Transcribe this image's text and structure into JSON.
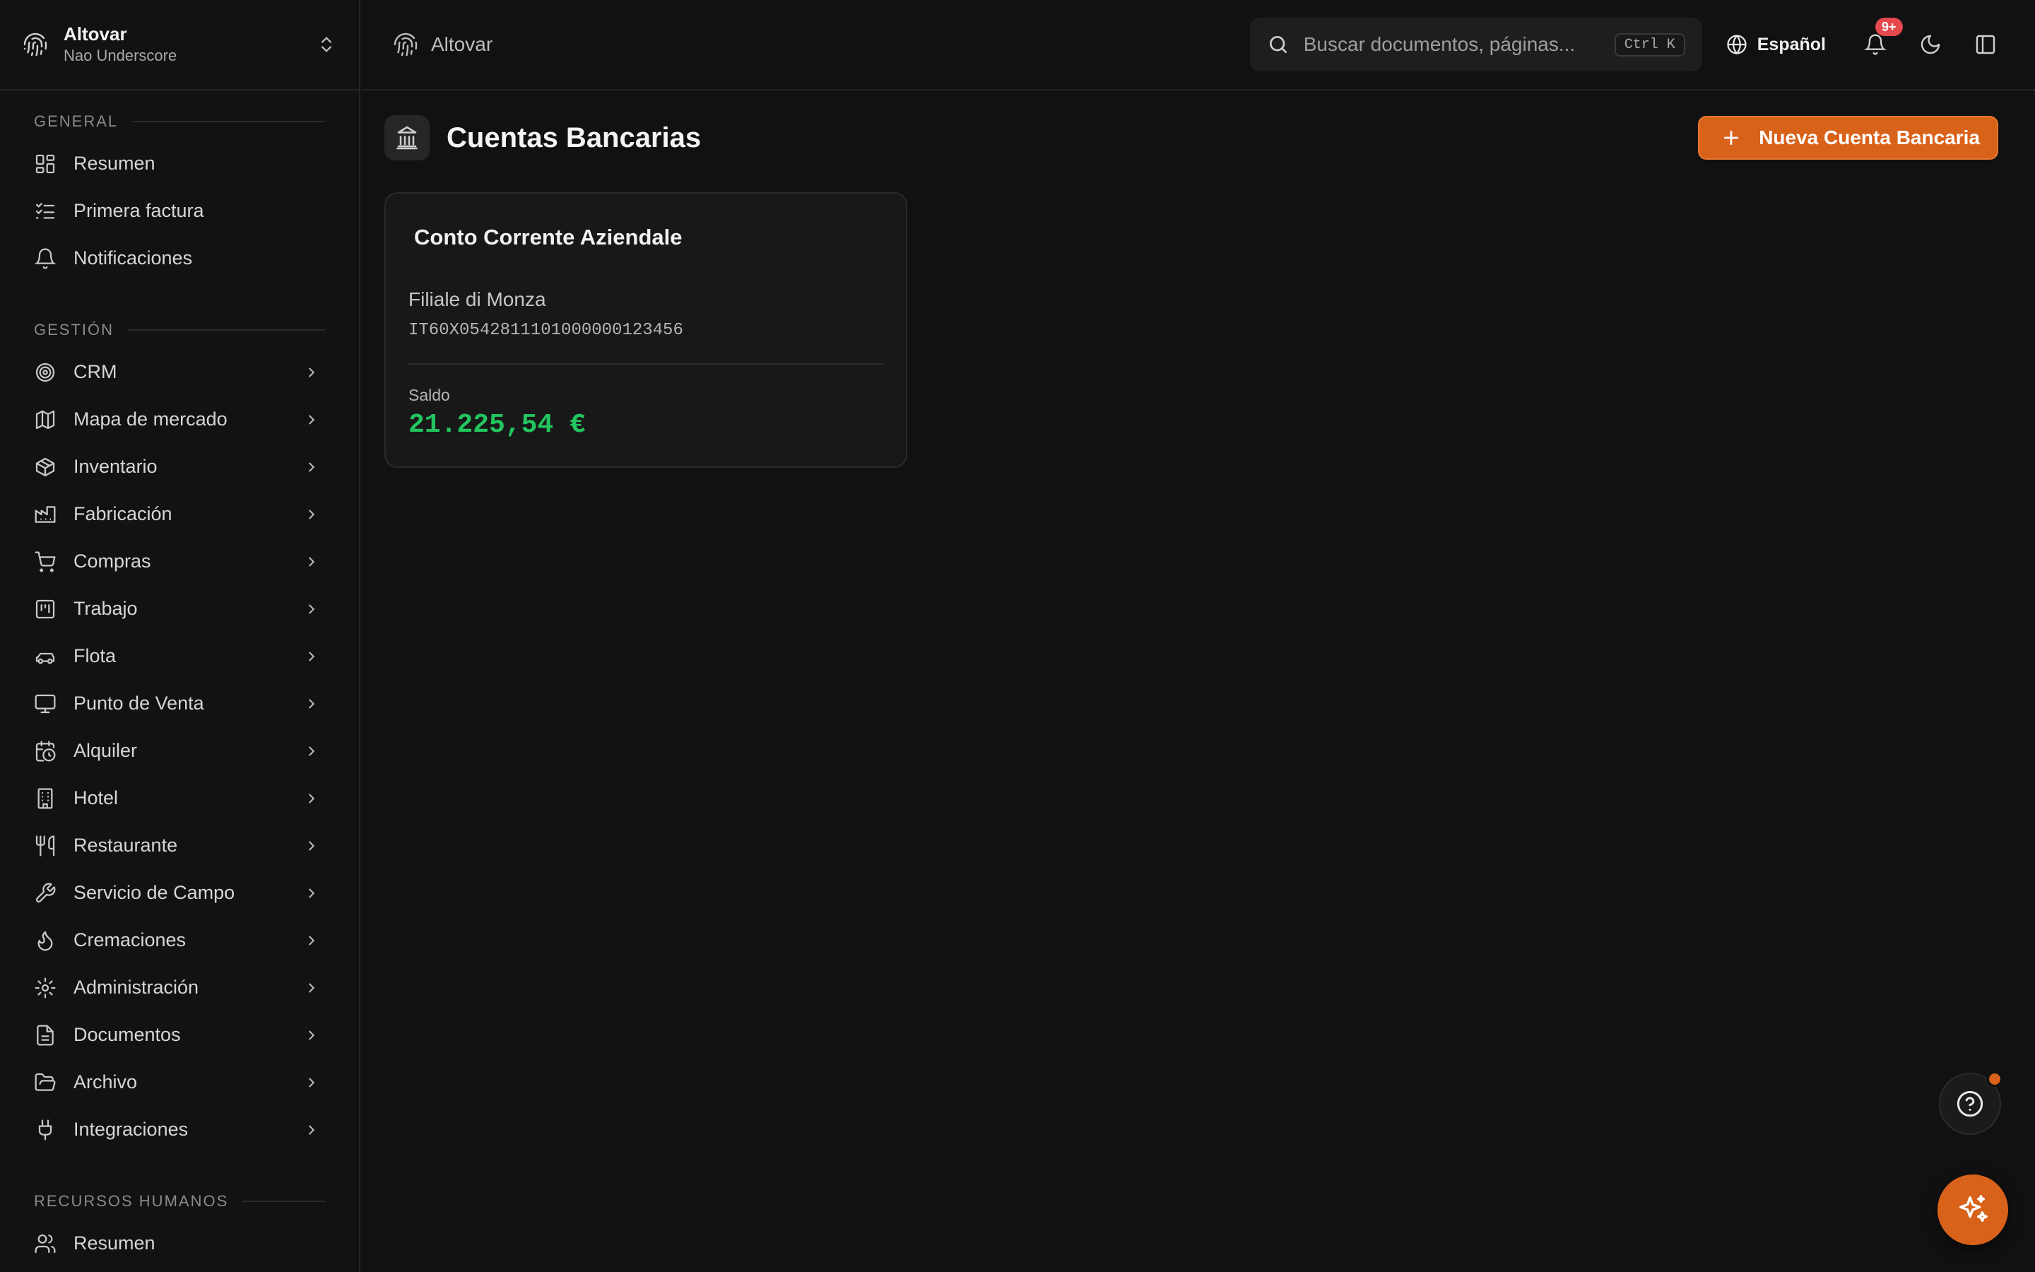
{
  "org": {
    "name": "Altovar",
    "subtitle": "Nao Underscore"
  },
  "sidebar": {
    "sections": [
      {
        "label": "GENERAL",
        "items": [
          {
            "label": "Resumen",
            "icon": "dashboard-icon"
          },
          {
            "label": "Primera factura",
            "icon": "checklist-icon"
          },
          {
            "label": "Notificaciones",
            "icon": "bell-icon"
          }
        ]
      },
      {
        "label": "GESTIÓN",
        "items": [
          {
            "label": "CRM",
            "icon": "target-icon"
          },
          {
            "label": "Mapa de mercado",
            "icon": "map-icon"
          },
          {
            "label": "Inventario",
            "icon": "package-icon"
          },
          {
            "label": "Fabricación",
            "icon": "factory-icon"
          },
          {
            "label": "Compras",
            "icon": "cart-icon"
          },
          {
            "label": "Trabajo",
            "icon": "kanban-icon"
          },
          {
            "label": "Flota",
            "icon": "car-icon"
          },
          {
            "label": "Punto de Venta",
            "icon": "monitor-icon"
          },
          {
            "label": "Alquiler",
            "icon": "calendar-clock-icon"
          },
          {
            "label": "Hotel",
            "icon": "building-icon"
          },
          {
            "label": "Restaurante",
            "icon": "utensils-icon"
          },
          {
            "label": "Servicio de Campo",
            "icon": "wrench-icon"
          },
          {
            "label": "Cremaciones",
            "icon": "flame-icon"
          },
          {
            "label": "Administración",
            "icon": "gear-icon"
          },
          {
            "label": "Documentos",
            "icon": "file-icon"
          },
          {
            "label": "Archivo",
            "icon": "folder-open-icon"
          },
          {
            "label": "Integraciones",
            "icon": "plug-icon"
          }
        ]
      },
      {
        "label": "RECURSOS HUMANOS",
        "items": [
          {
            "label": "Resumen",
            "icon": "users-icon"
          }
        ]
      }
    ]
  },
  "header": {
    "breadcrumb": "Altovar",
    "search_placeholder": "Buscar documentos, páginas...",
    "search_shortcut": "Ctrl K",
    "language": "Español",
    "notifications_badge": "9+"
  },
  "page": {
    "title": "Cuentas Bancarias",
    "new_button": "Nueva Cuenta Bancaria"
  },
  "accounts": [
    {
      "name": "Conto Corrente Aziendale",
      "branch": "Filiale di Monza",
      "iban": "IT60X0542811101000000123456",
      "balance_label": "Saldo",
      "balance": "21.225,54 €"
    }
  ],
  "colors": {
    "accent": "#d9621a",
    "positive": "#22c55e",
    "badge": "#e5484d"
  }
}
